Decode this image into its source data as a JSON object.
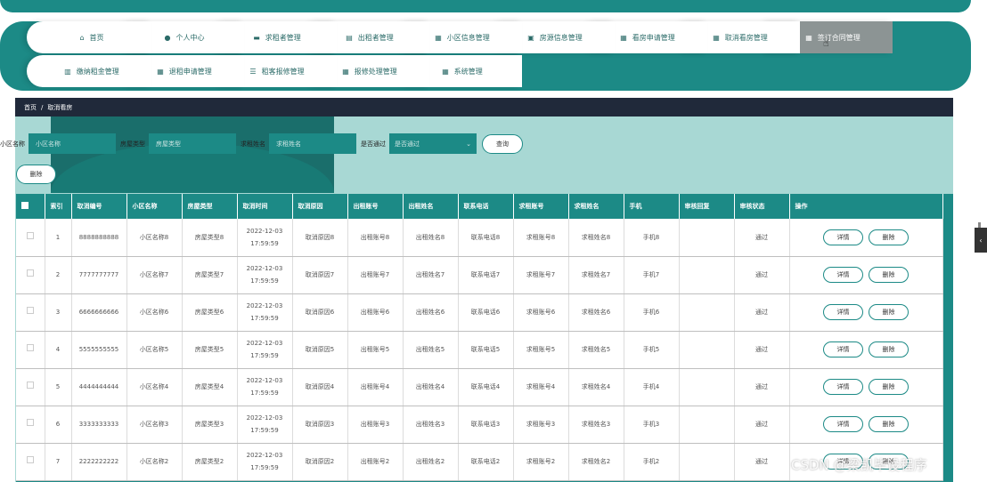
{
  "nav": {
    "row1": [
      {
        "label": "首页",
        "icon": "home-icon",
        "glyph": "⌂"
      },
      {
        "label": "个人中心",
        "icon": "user-icon",
        "glyph": "●"
      },
      {
        "label": "求租者管理",
        "icon": "chat-icon",
        "glyph": "▬"
      },
      {
        "label": "出租者管理",
        "icon": "clipboard-icon",
        "glyph": "▤"
      },
      {
        "label": "小区信息管理",
        "icon": "grid-icon",
        "glyph": "▦"
      },
      {
        "label": "房源信息管理",
        "icon": "briefcase-icon",
        "glyph": "▣"
      },
      {
        "label": "看房申请管理",
        "icon": "grid-icon",
        "glyph": "▦"
      },
      {
        "label": "取消看房管理",
        "icon": "grid-icon",
        "glyph": "▦"
      },
      {
        "label": "签订合同管理",
        "icon": "grid-icon",
        "glyph": "▦"
      }
    ],
    "row2": [
      {
        "label": "缴纳租金管理",
        "icon": "bar-chart-icon",
        "glyph": "▥"
      },
      {
        "label": "退租申请管理",
        "icon": "grid-icon",
        "glyph": "▦"
      },
      {
        "label": "租客报修管理",
        "icon": "sliders-icon",
        "glyph": "☰"
      },
      {
        "label": "报修处理管理",
        "icon": "grid-icon",
        "glyph": "▦"
      },
      {
        "label": "系统管理",
        "icon": "grid-icon",
        "glyph": "▦"
      }
    ]
  },
  "breadcrumb": {
    "home": "首页",
    "sep": "/",
    "current": "取消看房"
  },
  "search": {
    "community_label": "小区名称",
    "community_placeholder": "小区名称",
    "house_type_label": "房屋类型",
    "house_type_placeholder": "房屋类型",
    "tenant_name_label": "求租姓名",
    "tenant_name_placeholder": "求租姓名",
    "approved_label": "是否通过",
    "approved_placeholder": "是否通过",
    "query_button": "查询"
  },
  "delete_button": "删除",
  "table": {
    "headers": [
      "索引",
      "取消编号",
      "小区名称",
      "房屋类型",
      "取消时间",
      "取消原因",
      "出租账号",
      "出租姓名",
      "联系电话",
      "求租账号",
      "求租姓名",
      "手机",
      "审核回复",
      "审核状态",
      "操作"
    ],
    "rows": [
      {
        "idx": "1",
        "no": "8888888888",
        "community": "小区名称8",
        "type": "房屋类型8",
        "date": "2022-12-03",
        "time": "17:59:59",
        "reason": "取消原因8",
        "owner_acct": "出租账号8",
        "owner_name": "出租姓名8",
        "phone": "联系电话8",
        "tenant_acct": "求租账号8",
        "tenant_name": "求租姓名8",
        "mobile": "手机8",
        "reply": "",
        "status": "通过"
      },
      {
        "idx": "2",
        "no": "7777777777",
        "community": "小区名称7",
        "type": "房屋类型7",
        "date": "2022-12-03",
        "time": "17:59:59",
        "reason": "取消原因7",
        "owner_acct": "出租账号7",
        "owner_name": "出租姓名7",
        "phone": "联系电话7",
        "tenant_acct": "求租账号7",
        "tenant_name": "求租姓名7",
        "mobile": "手机7",
        "reply": "",
        "status": "通过"
      },
      {
        "idx": "3",
        "no": "6666666666",
        "community": "小区名称6",
        "type": "房屋类型6",
        "date": "2022-12-03",
        "time": "17:59:59",
        "reason": "取消原因6",
        "owner_acct": "出租账号6",
        "owner_name": "出租姓名6",
        "phone": "联系电话6",
        "tenant_acct": "求租账号6",
        "tenant_name": "求租姓名6",
        "mobile": "手机6",
        "reply": "",
        "status": "通过"
      },
      {
        "idx": "4",
        "no": "5555555555",
        "community": "小区名称5",
        "type": "房屋类型5",
        "date": "2022-12-03",
        "time": "17:59:59",
        "reason": "取消原因5",
        "owner_acct": "出租账号5",
        "owner_name": "出租姓名5",
        "phone": "联系电话5",
        "tenant_acct": "求租账号5",
        "tenant_name": "求租姓名5",
        "mobile": "手机5",
        "reply": "",
        "status": "通过"
      },
      {
        "idx": "5",
        "no": "4444444444",
        "community": "小区名称4",
        "type": "房屋类型4",
        "date": "2022-12-03",
        "time": "17:59:59",
        "reason": "取消原因4",
        "owner_acct": "出租账号4",
        "owner_name": "出租姓名4",
        "phone": "联系电话4",
        "tenant_acct": "求租账号4",
        "tenant_name": "求租姓名4",
        "mobile": "手机4",
        "reply": "",
        "status": "通过"
      },
      {
        "idx": "6",
        "no": "3333333333",
        "community": "小区名称3",
        "type": "房屋类型3",
        "date": "2022-12-03",
        "time": "17:59:59",
        "reason": "取消原因3",
        "owner_acct": "出租账号3",
        "owner_name": "出租姓名3",
        "phone": "联系电话3",
        "tenant_acct": "求租账号3",
        "tenant_name": "求租姓名3",
        "mobile": "手机3",
        "reply": "",
        "status": "通过"
      },
      {
        "idx": "7",
        "no": "2222222222",
        "community": "小区名称2",
        "type": "房屋类型2",
        "date": "2022-12-03",
        "time": "17:59:59",
        "reason": "取消原因2",
        "owner_acct": "出租账号2",
        "owner_name": "出租姓名2",
        "phone": "联系电话2",
        "tenant_acct": "求租账号2",
        "tenant_name": "求租姓名2",
        "mobile": "手机2",
        "reply": "",
        "status": "通过"
      }
    ],
    "detail_button": "详情",
    "row_delete_button": "删除"
  },
  "watermark": "CSDN @梁凯毕设程序",
  "colors": {
    "primary": "#1c8a86",
    "breadcrumb_bg": "#20293a",
    "content_bg": "#a8d8d4",
    "active_nav": "#8c9494"
  }
}
